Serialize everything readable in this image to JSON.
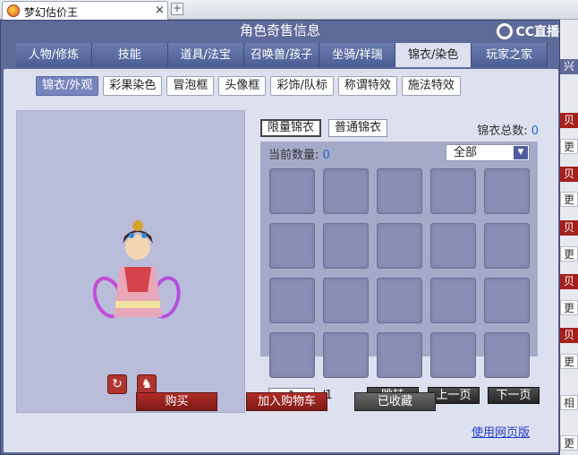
{
  "browser_tab": {
    "title": "梦幻估价王",
    "close": "×",
    "new_tab": "+"
  },
  "window": {
    "title": "角色奇售信息",
    "watermark": "CC直播"
  },
  "main_tabs": [
    {
      "label": "人物/修炼"
    },
    {
      "label": "技能"
    },
    {
      "label": "道具/法宝"
    },
    {
      "label": "召唤兽/孩子"
    },
    {
      "label": "坐骑/祥瑞"
    },
    {
      "label": "锦衣/染色",
      "active": true
    },
    {
      "label": "玩家之家"
    }
  ],
  "sub_tabs": [
    {
      "label": "锦衣/外观",
      "active": true
    },
    {
      "label": "彩果染色"
    },
    {
      "label": "冒泡框"
    },
    {
      "label": "头像框"
    },
    {
      "label": "彩饰/队标"
    },
    {
      "label": "称谓特效"
    },
    {
      "label": "施法特效"
    }
  ],
  "wardrobe": {
    "limited_label": "限量锦衣",
    "normal_label": "普通锦衣",
    "total_label": "锦衣总数:",
    "total_value": "0",
    "count_label": "当前数量:",
    "count_value": "0",
    "filter_value": "全部",
    "filter_arrow": "▼",
    "page_input": "1",
    "page_total": "/1",
    "jump_label": "跳转",
    "prev_label": "上一页",
    "next_label": "下一页"
  },
  "preview": {
    "rotate_icon": "↻",
    "action_icon": "♞"
  },
  "actions": {
    "buy_label": "购买",
    "cart_label": "加入购物车",
    "fav_label": "已收藏",
    "web_label": "使用网页版"
  },
  "right_strip": [
    {
      "text": "兴",
      "style": "blue"
    },
    {
      "text": "贝",
      "style": "red"
    },
    {
      "text": "更",
      "style": "white"
    },
    {
      "text": "贝",
      "style": "red"
    },
    {
      "text": "更",
      "style": "white"
    },
    {
      "text": "贝",
      "style": "red"
    },
    {
      "text": "更",
      "style": "white"
    },
    {
      "text": "贝",
      "style": "red"
    },
    {
      "text": "更",
      "style": "white"
    },
    {
      "text": "贝",
      "style": "red"
    },
    {
      "text": "更",
      "style": "white"
    },
    {
      "text": "相",
      "style": "white"
    },
    {
      "text": "更",
      "style": "white"
    }
  ],
  "colors": {
    "window": "#5e6a9a",
    "panel": "#dde0ee",
    "red_button": "#a3201d",
    "link": "#1f3bd0"
  }
}
